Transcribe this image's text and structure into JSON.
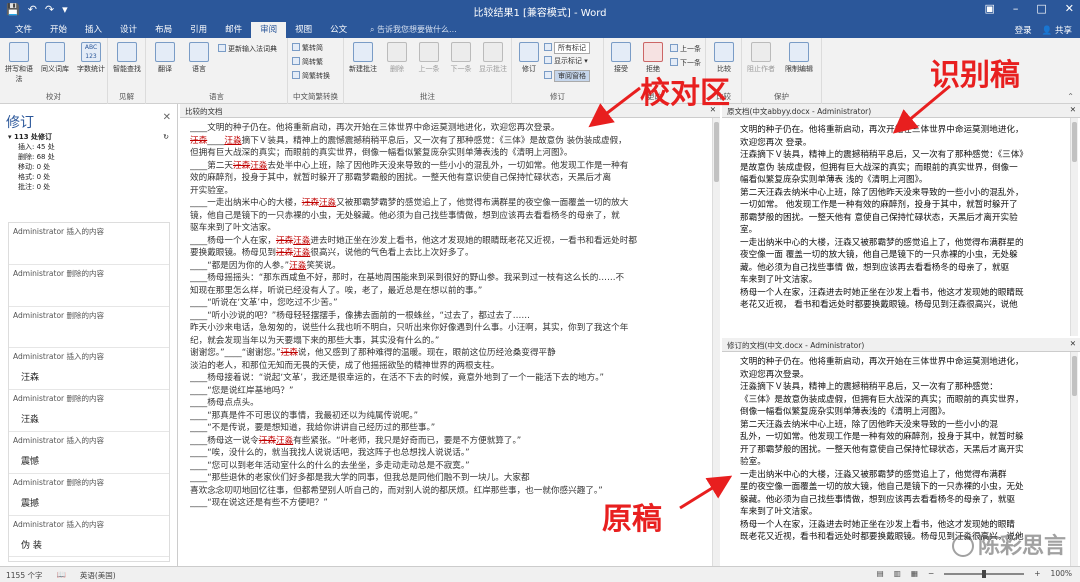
{
  "window": {
    "title": "比较结果1 [兼容模式] - Word",
    "login": "登录",
    "share": "共享"
  },
  "qat": {
    "save_icon": "save-icon",
    "undo_icon": "undo-icon",
    "redo_icon": "redo-icon"
  },
  "tabs": [
    "文件",
    "开始",
    "插入",
    "设计",
    "布局",
    "引用",
    "邮件",
    "审阅",
    "视图",
    "公文"
  ],
  "active_tab": "审阅",
  "tell_me": "告诉我您想要做什么...",
  "ribbon": {
    "proofing": {
      "label": "校对",
      "buttons": [
        "拼写和语法",
        "同义词库",
        "字数统计"
      ],
      "abc": "ABC 123"
    },
    "insights": {
      "label": "见解",
      "buttons": [
        "智能查找"
      ]
    },
    "language": {
      "label": "语言",
      "buttons": [
        "翻译",
        "语言"
      ],
      "update": "更新输入法词典"
    },
    "chinese": {
      "label": "中文简繁转换",
      "items": [
        "繁转简",
        "简转繁",
        "简繁转换"
      ]
    },
    "comments": {
      "label": "批注",
      "buttons": [
        "新建批注",
        "删除",
        "上一条",
        "下一条",
        "显示批注"
      ]
    },
    "tracking": {
      "label": "修订",
      "buttons": [
        "修订"
      ],
      "markup_dd": "所有标记",
      "show_markup": "显示标记",
      "pane_dd": "审阅窗格"
    },
    "changes": {
      "label": "更改",
      "buttons": [
        "接受",
        "拒绝"
      ],
      "prev": "上一条",
      "next": "下一条"
    },
    "compare": {
      "label": "比较",
      "buttons": [
        "比较"
      ]
    },
    "protect": {
      "label": "保护",
      "buttons": [
        "阻止作者",
        "限制编辑"
      ]
    }
  },
  "revisions_pane": {
    "title": "修订",
    "total": "113 处修订",
    "stats": [
      "插入: 45 处",
      "删除: 68 处",
      "移动: 0 处",
      "格式: 0 处",
      "批注: 0 处"
    ],
    "items": [
      {
        "author": "Administrator",
        "action": "插入的内容",
        "content": ""
      },
      {
        "author": "Administrator",
        "action": "删除的内容",
        "content": ""
      },
      {
        "author": "Administrator",
        "action": "删除的内容",
        "content": ""
      },
      {
        "author": "Administrator",
        "action": "插入的内容",
        "content": "汪森"
      },
      {
        "author": "Administrator",
        "action": "删除的内容",
        "content": "汪淼"
      },
      {
        "author": "Administrator",
        "action": "插入的内容",
        "content": "震憾"
      },
      {
        "author": "Administrator",
        "action": "删除的内容",
        "content": "震撼"
      },
      {
        "author": "Administrator",
        "action": "插入的内容",
        "content": "伪 装"
      }
    ]
  },
  "combined": {
    "header": "比较的文档",
    "lines": [
      "____文明的种子仍在。他将重新启动，再次开始在三体世界中命运莫测地进化，欢迎您再次登录。",
      "汪森____汪淼摘下Ｖ装具，精神上的震憾震撼稍稍平息后，又一次有了那种感觉：《三体》是故意伪 装伪装成虚假，",
      "但拥有巨大战深的真实；而眼前的真实世界，倒像一幅看似繁复庞杂实则单薄表浅的《清明上河图》。",
      "____第二天汪森汪淼去处半中心上班，除了因他昨天没来导致的一些小小的混乱外，一切如常。他发现工作是一种有",
      "效的麻醉剂，投身于其中，就暂时躲开了那霸梦霸般的困扰。一整天他有意识使自己保持忙碌状态，天黑后才离",
      "开实验室。",
      "____一走出纳米中心的大楼，汪森汪淼又被那霸梦霸梦的感觉追上了，他觉得布满群星的夜空像一面覆盖一切的放大",
      "镜，他自己是镜下的一只赤裸的小虫，无处躲藏。他必须为自己找些事情做，想到应该再去看看杨冬的母亲了，就",
      "驱车来到了叶文洁家。",
      "____杨母一个人在家，汪森汪淼进去时她正坐在沙发上看书，他这才发现她的眼睛既老花又近视，一看书和看远处时都",
      "要换戴眼镜。杨母见到汪森汪淼很高兴，说他的气色看上去比上次好多了。",
      "____“都是因为你的人参。”汪淼笑笑说。",
      "____杨母摇摇头：“那东西咸鱼不好，那时，在基地周围能来到采到很好的野山参。我采到过一枝有这么长的……不",
      "知现在那里怎么样，听说已经没有人了。唉，老了，最近总是在想以前的事。”",
      "____“听说在‘文革’中，您吃过不少苦。”",
      "____“听小沙说的吧？”杨母轻轻摆摆手，像拂去面前的一根蛛丝，“过去了，都过去了……",
      "昨天小沙来电话，急匆匆的，说些什么我也听不明白，只听出来你好像遇到什么事。小汪啊，其实，你到了我这个年",
      "纪，就会发现当年以为天要塌下来的那些大事，其实没有什么的。”",
      "谢谢您。”____“谢谢您。”汪森说，他又感到了那种难得的温暖。现在，眼前这位历经沧桑变得平静",
      "淡泊的老人，和那位无知而无畏的天使，成了他摇摇欲坠的精神世界的两根支柱。",
      "____杨母接着说：“说起‘文革’，我还是很幸运的，在活不下去的时候，竟意外地到了一个一能活下去的地方。”",
      "____“您是说红岸基地吗？”",
      "____杨母点点头。",
      "____“那真是件不可思议的事情，我最初还以为纯属传说呢。”",
      "____“不是传说，要是想知道，我给你讲讲自己经历过的那些事。”",
      "____杨母这一说令汪森汪淼有些紧张。“叶老师，我只是好奇而已，要是不方便就算了。”",
      "____“唉，没什么的，就当我找人说说话吧，我这阵子也总想找人说说话。”",
      "____“您可以到老年活动室什么的什么的去坐坐，多走动走动总是不寂寞。”",
      "____“那些退休的老家伙们好多都是我大学的同事，但我总是同他们融不到一块儿。大家都",
      "喜欢念念叨叨地回忆往事，但都希望别人听自己的，而对别人说的都厌烦。红岸那些事，也一就你感兴趣了。”",
      "____“现在说这还是有些不方便吧？”"
    ]
  },
  "original": {
    "header": "原文档(中文abbyy.docx - Administrator)",
    "lines": [
      "文明的种子仍在。他将重新启动，再次开始在三体世界中命运莫测地进化，",
      "欢迎您再次 登录。",
      "汪森摘下Ｖ装具，精神上的震撼稍稍平息后，又一次有了那种感觉：《三体》",
      "是故意伪 装成虚假，但拥有巨大战深的真实；而眼前的真实世界，倒像一",
      "幅看似繁复庞杂实则单薄表 浅的《清明上河图》。",
      "第二天汪森去纳米中心上班，除了因他昨天没来导致的一些小小的混乱外，",
      "一切如常。 他发现工作是一种有效的麻醉剂，投身于其中，就暂时躲开了",
      "那霸梦般的困扰。一整天他有 意使自己保持忙碌状态，天黑后才离开实验",
      "室。",
      "一走出纳米中心的大楼，汪森又被那霸梦的感觉追上了，他觉得布满群星的",
      "夜空像一面 覆盖一切的放大镜，他自己是镜下的一只赤裸的小虫，无处躲",
      "藏。他必须为自己找些事情 做，想到应该再去看看杨冬的母亲了，就驱",
      "车来到了叶文洁家。",
      "杨母一个人在家，汪森进去时她正坐在沙发上看书，他这才发现她的眼睛既",
      "老花又近视， 看书和看远处时都要换戴眼镜。杨母见到汪森很高兴，说他"
    ]
  },
  "revised": {
    "header": "修订的文档(中文.docx - Administrator)",
    "lines": [
      "文明的种子仍在。他将重新启动，再次开始在三体世界中命运莫测地进化，",
      "欢迎您再次登录。",
      "汪淼摘下Ｖ装具，精神上的震撼稍稍平息后，又一次有了那种感觉：",
      "《三体》是故意伪装成虚假，但拥有巨大战深的真实；而眼前的真实世界，",
      "倒像一幅看似繁复庞杂实则单薄表浅的《清明上河图》。",
      "第二天汪淼去纳米中心上班，除了因他昨天没来导致的一些小小的混",
      "乱外，一切如常。他发现工作是一种有效的麻醉剂，投身于其中，就暂时躲",
      "开了那霸梦般的困扰。一整天他有意使自己保持忙碌状态，天黑后才离开实",
      "验室。",
      "一走出纳米中心的大楼，汪淼又被那霸梦的感觉追上了，他觉得布满群",
      "星的夜空像一面覆盖一切的放大镜，他自己是镜下的一只赤裸的小虫，无处",
      "躲藏。他必须为自己找些事情做，想到应该再去看看杨冬的母亲了，就驱",
      "车来到了叶文洁家。",
      "杨母一个人在家，汪淼进去时她正坐在沙发上看书，他这才发现她的眼睛",
      "既老花又近视，看书和看远处时都要换戴眼镜。杨母见到汪淼很高兴，说他"
    ]
  },
  "annotations": {
    "proof": "校对区",
    "recognized": "识别稿",
    "original": "原稿"
  },
  "watermark": "陈彩思言",
  "status": {
    "words": "1155 个字",
    "lang": "英语(美国)",
    "zoom": "100%"
  },
  "colors": {
    "brand": "#2b579a",
    "revision": "#c00000",
    "annotation": "#e81f1f"
  }
}
